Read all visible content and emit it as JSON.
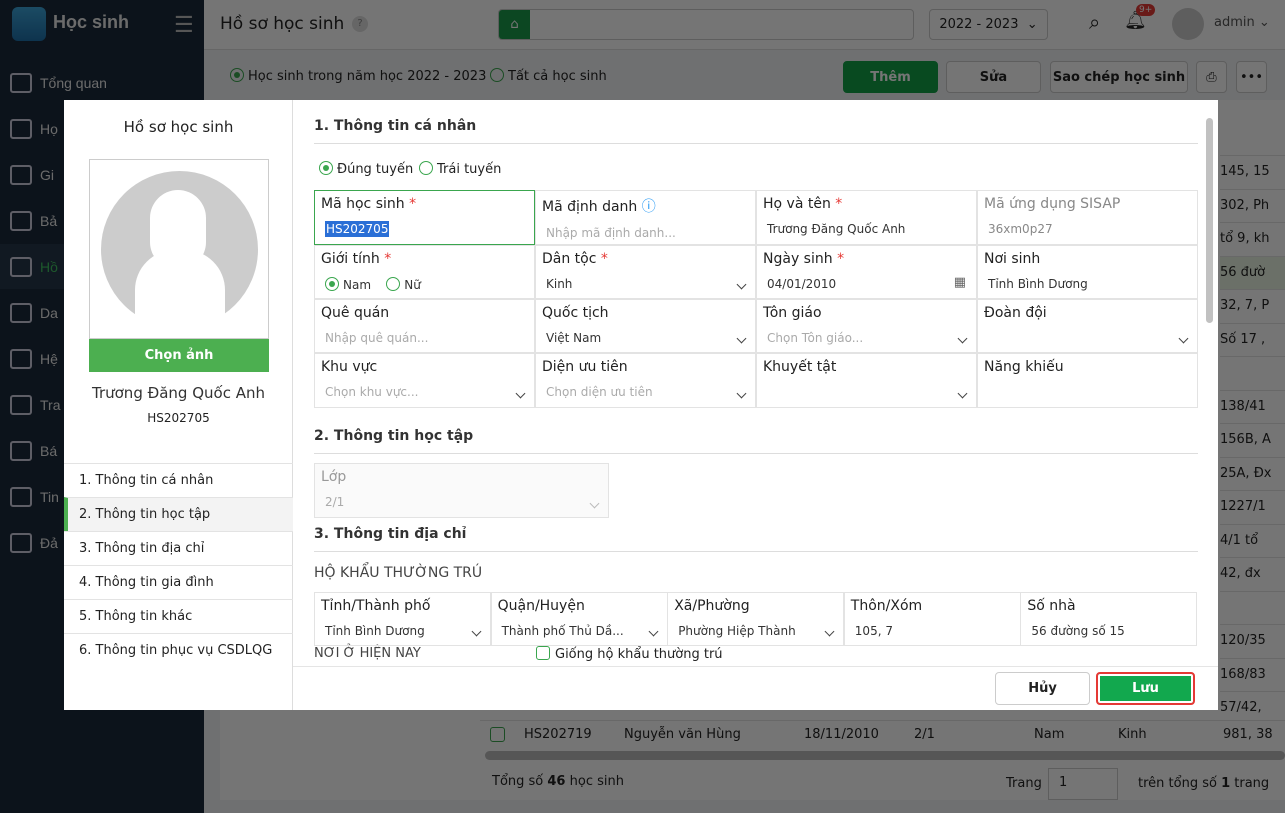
{
  "app": {
    "name": "Học sinh"
  },
  "sidebar": {
    "items": [
      {
        "label": "Tổng quan"
      },
      {
        "label": "Họ"
      },
      {
        "label": "Gi"
      },
      {
        "label": "Bả"
      },
      {
        "label": "Hồ"
      },
      {
        "label": "Da"
      },
      {
        "label": "Hệ"
      },
      {
        "label": "Tra"
      },
      {
        "label": "Bá"
      },
      {
        "label": "Tin"
      },
      {
        "label": "Đả"
      }
    ]
  },
  "header": {
    "title": "Hồ sơ học sinh",
    "help": "?",
    "year": "2022 - 2023",
    "notif_badge": "9+",
    "user": "admin"
  },
  "filter": {
    "option1": "Học sinh trong năm học 2022 - 2023",
    "option2": "Tất cả học sinh"
  },
  "toolbar": {
    "add": "Thêm",
    "edit": "Sửa",
    "copy": "Sao chép học sinh"
  },
  "bg_table": {
    "addresses": [
      "145, 15",
      "302, Ph",
      "tổ 9, kh",
      "56 đườ",
      "32, 7, P",
      "Số 17 ,",
      "",
      "138/41",
      "156B, A",
      "25A, Đx",
      "1227/1",
      "4/1 tổ",
      "42, đx",
      "",
      "120/35",
      "168/83",
      "57/42,"
    ],
    "row": {
      "code": "HS202719",
      "name": "Nguyễn văn Hùng",
      "dob": "18/11/2010",
      "class": "2/1",
      "gender": "Nam",
      "ethnic": "Kinh",
      "addr": "981, 38"
    },
    "total_prefix": "Tổng số",
    "total": "46",
    "total_suffix": "học sinh",
    "page_label": "Trang",
    "page": "1",
    "page_suffix": "trên tổng số",
    "pages": "1",
    "pages_suffix": "trang"
  },
  "modal": {
    "left": {
      "title": "Hồ sơ học sinh",
      "choose_photo": "Chọn ảnh",
      "name": "Trương Đăng Quốc Anh",
      "code": "HS202705",
      "nav": [
        "1. Thông tin cá nhân",
        "2. Thông tin học tập",
        "3. Thông tin địa chỉ",
        "4. Thông tin gia đình",
        "5. Thông tin khác",
        "6. Thông tin phục vụ CSDLQG"
      ]
    },
    "s1": "1. Thông tin cá nhân",
    "route1": "Đúng tuyến",
    "route2": "Trái tuyến",
    "f": {
      "ma_hs": {
        "label": "Mã học sinh",
        "value": "HS202705"
      },
      "ma_dd": {
        "label": "Mã định danh",
        "placeholder": "Nhập mã định danh..."
      },
      "ho_ten": {
        "label": "Họ và tên",
        "value": "Trương Đăng Quốc Anh"
      },
      "sisap": {
        "label": "Mã ứng dụng SISAP",
        "value": "36xm0p27"
      },
      "gioi_tinh": {
        "label": "Giới tính",
        "opt1": "Nam",
        "opt2": "Nữ"
      },
      "dan_toc": {
        "label": "Dân tộc",
        "value": "Kinh"
      },
      "ngay_sinh": {
        "label": "Ngày sinh",
        "value": "04/01/2010"
      },
      "noi_sinh": {
        "label": "Nơi sinh",
        "value": "Tỉnh Bình Dương"
      },
      "que_quan": {
        "label": "Quê quán",
        "placeholder": "Nhập quê quán..."
      },
      "quoc_tich": {
        "label": "Quốc tịch",
        "value": "Việt Nam"
      },
      "ton_giao": {
        "label": "Tôn giáo",
        "placeholder": "Chọn Tôn giáo..."
      },
      "doan_doi": {
        "label": "Đoàn đội",
        "value": ""
      },
      "khu_vuc": {
        "label": "Khu vực",
        "placeholder": "Chọn khu vực..."
      },
      "dien_ut": {
        "label": "Diện ưu tiên",
        "placeholder": "Chọn diện ưu tiên"
      },
      "khuyet_tat": {
        "label": "Khuyết tật",
        "value": ""
      },
      "nang_khieu": {
        "label": "Năng khiếu",
        "value": ""
      }
    },
    "s2": "2. Thông tin học tập",
    "lop": {
      "label": "Lớp",
      "value": "2/1"
    },
    "s3": "3. Thông tin địa chỉ",
    "hk": "HỘ KHẨU THƯỜNG TRÚ",
    "addr": [
      {
        "label": "Tỉnh/Thành phố",
        "value": "Tỉnh Bình Dương"
      },
      {
        "label": "Quận/Huyện",
        "value": "Thành phố Thủ Dầ..."
      },
      {
        "label": "Xã/Phường",
        "value": "Phường Hiệp Thành"
      },
      {
        "label": "Thôn/Xóm",
        "value": "105, 7"
      },
      {
        "label": "Số nhà",
        "value": "56 đường số 15"
      }
    ],
    "current": "NƠI Ở HIỆN NAY",
    "same": "Giống hộ khẩu thường trú",
    "cancel": "Hủy",
    "save": "Lưu"
  }
}
